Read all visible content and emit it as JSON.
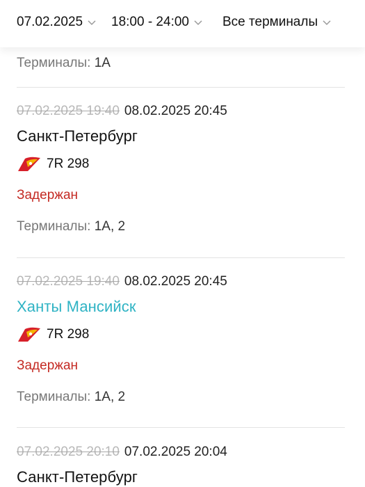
{
  "filters": {
    "date": "07.02.2025",
    "time_range": "18:00 - 24:00",
    "terminal": "Все терминалы"
  },
  "terminals_label": "Терминалы:",
  "top_terminals_value": "1A",
  "flights": [
    {
      "scheduled": "07.02.2025 19:40",
      "actual": "08.02.2025 20:45",
      "city": "Санкт-Петербург",
      "flight_number": "7R 298",
      "status": "Задержан",
      "terminals": "1A, 2"
    },
    {
      "scheduled": "07.02.2025 19:40",
      "actual": "08.02.2025 20:45",
      "city": "Ханты Мансийск",
      "flight_number": "7R 298",
      "status": "Задержан",
      "terminals": "1A, 2"
    },
    {
      "scheduled": "07.02.2025 20:10",
      "actual": "07.02.2025 20:04",
      "city": "Санкт-Петербург"
    }
  ],
  "colors": {
    "status_delayed": "#c42a23",
    "city_link": "#2fb3c4",
    "airline_logo": "#d7202a"
  },
  "icons": {
    "dropdown": "chevron-down-icon",
    "airline": "airline-logo-icon"
  }
}
